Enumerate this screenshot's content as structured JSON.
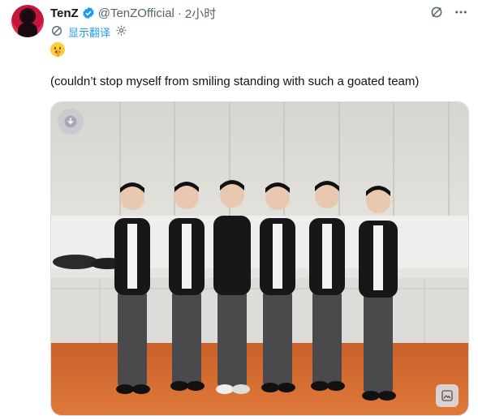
{
  "author": {
    "name": "TenZ",
    "handle": "@TenZOfficial",
    "separator": "·",
    "time": "2小时"
  },
  "translate": {
    "label": "显示翻译"
  },
  "tweet": {
    "emoji_name": "shushing-face-emoji",
    "text": "(couldn’t stop myself from smiling standing with such a goated team)"
  },
  "icons": {
    "verified": "verified-badge-icon",
    "grok": "grok-icon",
    "more": "more-icon",
    "translate": "translate-icon",
    "settings": "gear-icon",
    "gif_badge": "download-icon",
    "alt_badge": "image-edit-icon"
  },
  "colors": {
    "accent": "#1d9bf0",
    "text_primary": "#0f1419",
    "text_secondary": "#536471",
    "floor": "#d9692a"
  }
}
